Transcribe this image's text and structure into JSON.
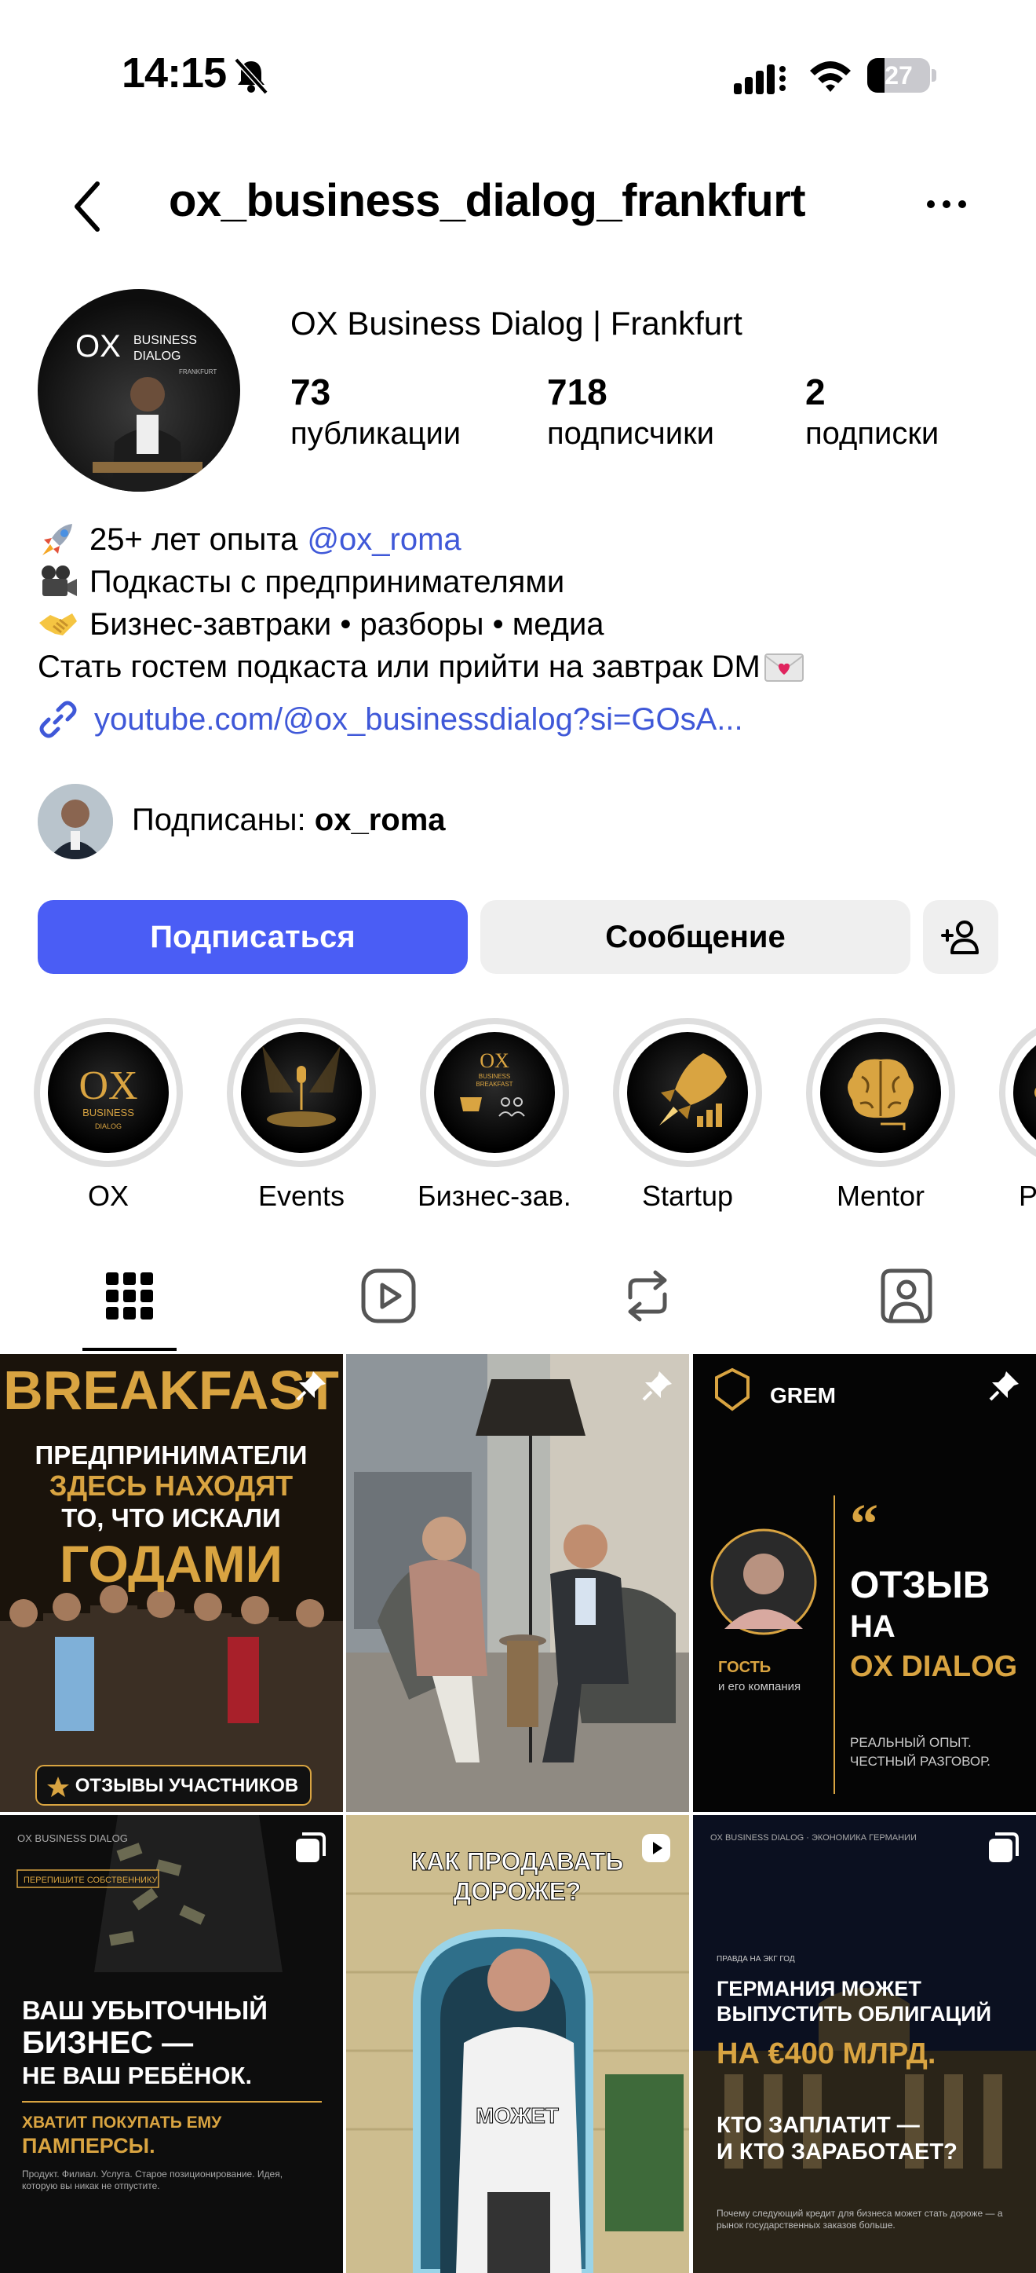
{
  "status_bar": {
    "time": "14:15",
    "battery": "27",
    "battery_level": 0.27
  },
  "header": {
    "username": "ox_business_dialog_frankfurt"
  },
  "profile": {
    "display_name": "OX Business Dialog | Frankfurt",
    "avatar_brand": "OX",
    "avatar_brand_line": "BUSINESS",
    "avatar_brand_line2": "DIALOG",
    "avatar_city": "FRANKFURT",
    "stats": [
      {
        "value": "73",
        "label": "публикации"
      },
      {
        "value": "718",
        "label": "подписчики"
      },
      {
        "value": "2",
        "label": "подписки"
      }
    ],
    "bio": {
      "line1": "25+ лет опыта",
      "line1_mention": "@ox_roma",
      "line2": "Подкасты с предпринимателями",
      "line3": "Бизнес-завтраки • разборы • медиа",
      "line4": "Стать гостем подкаста или прийти на завтрак DM"
    },
    "link": "youtube.com/@ox_businessdialog?si=GOsA...",
    "followed_by_prefix": "Подписаны:",
    "followed_by_user": "ox_roma"
  },
  "actions": {
    "follow": "Подписаться",
    "message": "Сообщение"
  },
  "highlights": [
    {
      "label": "OX",
      "icon": "ox-logo-icon"
    },
    {
      "label": "Events",
      "icon": "microphone-stage-icon"
    },
    {
      "label": "Бизнес-зав...",
      "icon": "breakfast-icon"
    },
    {
      "label": "Startup",
      "icon": "rocket-icon"
    },
    {
      "label": "Mentor",
      "icon": "brain-icon"
    },
    {
      "label": "P",
      "icon": "highlight-icon"
    }
  ],
  "tabs": [
    {
      "name": "posts",
      "icon": "grid-icon",
      "active": true
    },
    {
      "name": "reels",
      "icon": "reels-icon"
    },
    {
      "name": "reposts",
      "icon": "repost-icon"
    },
    {
      "name": "tagged",
      "icon": "tagged-person-icon"
    }
  ],
  "posts": [
    {
      "title": "BREAKFAST",
      "line1": "ПРЕДПРИНИМАТЕЛИ",
      "line2": "ЗДЕСЬ НАХОДЯТ",
      "line3": "ТО, ЧТО ИСКАЛИ",
      "line4": "ГОДАМИ",
      "badge": "ОТЗЫВЫ УЧАСТНИКОВ",
      "icon": "pin-icon"
    },
    {
      "icon": "pin-icon"
    },
    {
      "brand": "GREM",
      "quote": "“",
      "line1": "ОТЗЫВ",
      "line2": "НА",
      "line3": "OX DIALOG",
      "guest": "ГОСТЬ",
      "guest_sub": "и его компания",
      "footer1": "РЕАЛЬНЫЙ ОПЫТ.",
      "footer2": "ЧЕСТНЫЙ РАЗГОВОР.",
      "icon": "pin-icon"
    },
    {
      "top": "OX BUSINESS DIALOG",
      "tag": "ПЕРЕПИШИТЕ СОБСТВЕННИКУ",
      "line1": "ВАШ УБЫТОЧНЫЙ",
      "line2": "БИЗНЕС —",
      "line3": "НЕ ВАШ РЕБЁНОК.",
      "line4": "ХВАТИТ ПОКУПАТЬ ЕМУ",
      "line5": "ПАМПЕРСЫ.",
      "small": "Продукт. Филиал. Услуга. Старое позиционирование. Идея, которую вы никак не отпустите.",
      "icon": "carousel-icon"
    },
    {
      "caption_top": "КАК ПРОДАВАТЬ ДОРОЖЕ?",
      "caption_mid": "МОЖЕТ",
      "icon": "reel-icon"
    },
    {
      "top": "OX BUSINESS DIALOG · ЭКОНОМИКА ГЕРМАНИИ",
      "tag": "ПРАВДА НА ЭКГ ГОД",
      "line1": "ГЕРМАНИЯ МОЖЕТ",
      "line2": "ВЫПУСТИТЬ ОБЛИГАЦИЙ",
      "line3": "НА €400 МЛРД.",
      "line4": "КТО ЗАПЛАТИТ —",
      "line5": "И КТО ЗАРАБОТАЕТ?",
      "small": "Почему следующий кредит для бизнеса может стать дороже — а рынок государственных заказов больше.",
      "icon": "carousel-icon"
    }
  ],
  "colors": {
    "accent": "#4a5df5",
    "link": "#3f58d8",
    "gold": "#d9a441",
    "button_bg": "#efefef"
  }
}
